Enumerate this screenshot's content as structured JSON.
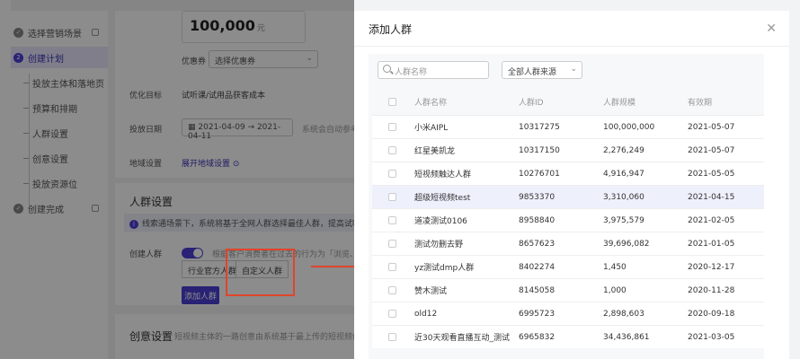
{
  "sidebar": {
    "steps": [
      {
        "label": "选择营销场景",
        "num": "✓"
      },
      {
        "label": "创建计划",
        "num": "2"
      },
      {
        "label": "创建完成",
        "num": "✓"
      }
    ],
    "substeps": [
      "投放主体和落地页",
      "预算和排期",
      "人群设置",
      "创意设置",
      "投放资源位"
    ]
  },
  "form": {
    "price": "100,000",
    "price_unit": "元",
    "coupon_label": "优惠券",
    "coupon_select": "选择优惠券",
    "goal_label": "优化目标",
    "goal_value": "试听课/试用品获客成本",
    "date_label": "投放日期",
    "date_start": "2021-04-09",
    "date_end": "2021-04-11",
    "date_hint": "系统会自动参考",
    "region_label": "地域设置",
    "region_link": "展开地域设置",
    "audience_title": "人群设置",
    "info_text": "线索通场景下，系统将基于全网人群选择最佳人群，提高试听课或交",
    "create_audience_label": "创建人群",
    "toggle_hint": "根据客户消费者在过去的行为为「浏览、搜索」",
    "seg_industry": "行业官方人群",
    "seg_custom": "自定义人群",
    "add_button": "添加人群",
    "creative_title": "创意设置",
    "creative_hint": "短视频主体的一路创意由系统基于最上传的短视频创意生成"
  },
  "modal": {
    "title": "添加人群",
    "search_placeholder": "人群名称",
    "source_select": "全部人群来源",
    "columns": [
      "人群名称",
      "人群ID",
      "人群规模",
      "有效期"
    ],
    "rows": [
      {
        "name": "小米AIPL",
        "id": "10317275",
        "size": "100,000,000",
        "expiry": "2021-05-07"
      },
      {
        "name": "红星美凯龙",
        "id": "10317150",
        "size": "2,276,249",
        "expiry": "2021-05-07"
      },
      {
        "name": "短视频触达人群",
        "id": "10276701",
        "size": "4,916,947",
        "expiry": "2021-05-05"
      },
      {
        "name": "超级短视频test",
        "id": "9853370",
        "size": "3,310,060",
        "expiry": "2021-04-15"
      },
      {
        "name": "道凌测试0106",
        "id": "8958840",
        "size": "3,975,579",
        "expiry": "2021-02-05"
      },
      {
        "name": "测试勿删去野",
        "id": "8657623",
        "size": "39,696,082",
        "expiry": "2021-01-05"
      },
      {
        "name": "yz测试dmp人群",
        "id": "8402274",
        "size": "1,450",
        "expiry": "2020-12-17"
      },
      {
        "name": "赞木测试",
        "id": "8145058",
        "size": "1,000",
        "expiry": "2020-11-28"
      },
      {
        "name": "old12",
        "id": "6995723",
        "size": "2,898,603",
        "expiry": "2020-09-18"
      },
      {
        "name": "近30天观看直播互动_测试",
        "id": "6965832",
        "size": "34,436,861",
        "expiry": "2021-03-05"
      }
    ]
  },
  "colors": {
    "accent": "#4b3fd6",
    "annotation": "#e0442b"
  }
}
